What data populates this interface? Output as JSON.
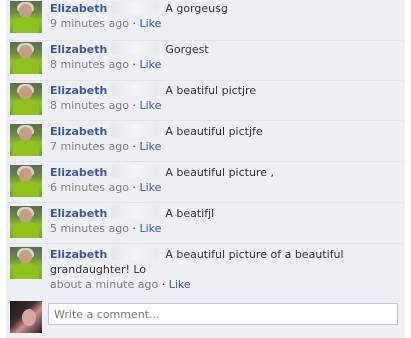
{
  "comments": [
    {
      "name": "Elizabeth",
      "text": "A gorgeusg",
      "time": "9 minutes ago",
      "dot": "·",
      "like": "Like"
    },
    {
      "name": "Elizabeth",
      "text": "Gorgest",
      "time": "8 minutes ago",
      "dot": "·",
      "like": "Like"
    },
    {
      "name": "Elizabeth",
      "text": "A beatiful pictjre",
      "time": "8 minutes ago",
      "dot": "·",
      "like": "Like"
    },
    {
      "name": "Elizabeth",
      "text": "A beautiful pictjfe",
      "time": "7 minutes ago",
      "dot": "·",
      "like": "Like"
    },
    {
      "name": "Elizabeth",
      "text": "A beautiful picture ,",
      "time": "6 minutes ago",
      "dot": "·",
      "like": "Like"
    },
    {
      "name": "Elizabeth",
      "text": "A beatifjl",
      "time": "5 minutes ago",
      "dot": "·",
      "like": "Like"
    },
    {
      "name": "Elizabeth",
      "text": "A beautiful picture of a beautiful",
      "text_line2": "grandaughter! Lo",
      "time": "about a minute ago",
      "dot": "·",
      "like": "Like"
    }
  ],
  "composer": {
    "placeholder": "Write a comment..."
  },
  "colors": {
    "panel_bg": "#edeff4",
    "link": "#3b5998",
    "meta": "#808080"
  }
}
